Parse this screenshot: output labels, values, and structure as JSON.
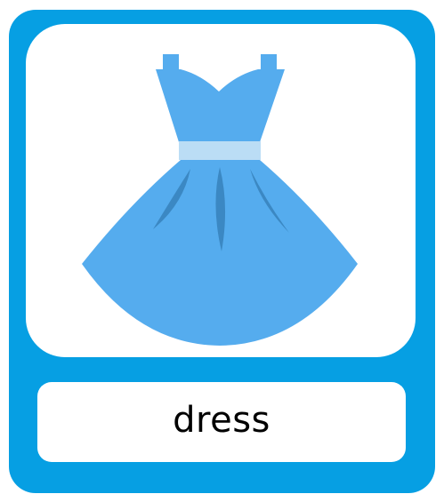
{
  "card": {
    "word": "dress",
    "border_color": "#069fe3",
    "background_color": "#ffffff"
  },
  "illustration": {
    "icon": "dress-icon",
    "colors": {
      "dress": "#55acee",
      "belt": "#bbddf5",
      "pleats": "#3b88c3"
    }
  }
}
